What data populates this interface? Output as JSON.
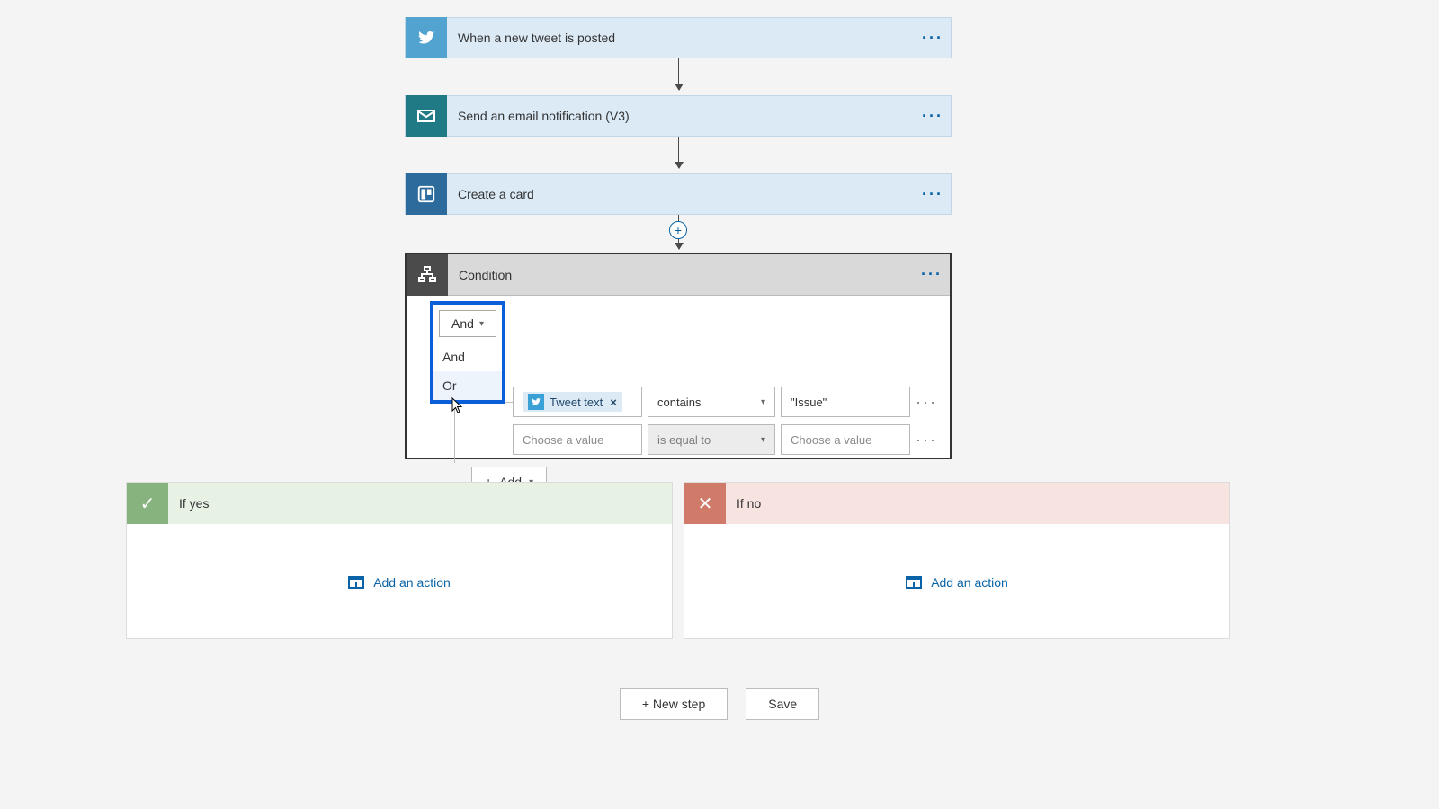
{
  "steps": [
    {
      "title": "When a new tweet is posted"
    },
    {
      "title": "Send an email notification (V3)"
    },
    {
      "title": "Create a card"
    }
  ],
  "condition": {
    "title": "Condition",
    "logic_selected": "And",
    "logic_options": [
      "And",
      "Or"
    ],
    "rows": [
      {
        "left_token": "Tweet text",
        "operator": "contains",
        "right": "\"Issue\"",
        "disabled": false
      },
      {
        "left_placeholder": "Choose a value",
        "operator": "is equal to",
        "right_placeholder": "Choose a value",
        "disabled": true
      }
    ],
    "add_label": "Add"
  },
  "branches": {
    "yes_title": "If yes",
    "no_title": "If no",
    "add_action_label": "Add an action"
  },
  "footer": {
    "new_step": "+ New step",
    "save": "Save"
  },
  "menu_glyph": "···"
}
